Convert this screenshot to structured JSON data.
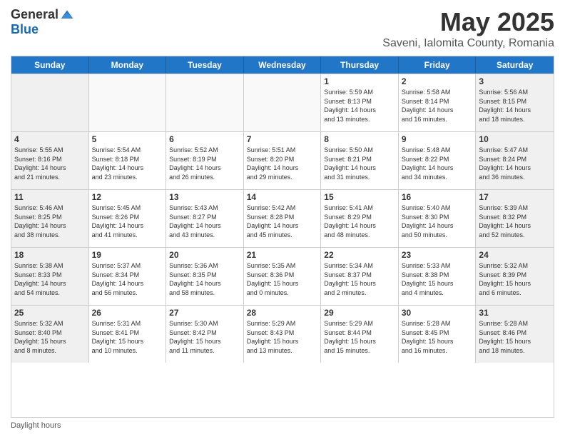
{
  "logo": {
    "general": "General",
    "blue": "Blue"
  },
  "title": "May 2025",
  "subtitle": "Saveni, Ialomita County, Romania",
  "days": [
    "Sunday",
    "Monday",
    "Tuesday",
    "Wednesday",
    "Thursday",
    "Friday",
    "Saturday"
  ],
  "rows": [
    [
      {
        "num": "",
        "info": ""
      },
      {
        "num": "",
        "info": ""
      },
      {
        "num": "",
        "info": ""
      },
      {
        "num": "",
        "info": ""
      },
      {
        "num": "1",
        "info": "Sunrise: 5:59 AM\nSunset: 8:13 PM\nDaylight: 14 hours\nand 13 minutes."
      },
      {
        "num": "2",
        "info": "Sunrise: 5:58 AM\nSunset: 8:14 PM\nDaylight: 14 hours\nand 16 minutes."
      },
      {
        "num": "3",
        "info": "Sunrise: 5:56 AM\nSunset: 8:15 PM\nDaylight: 14 hours\nand 18 minutes."
      }
    ],
    [
      {
        "num": "4",
        "info": "Sunrise: 5:55 AM\nSunset: 8:16 PM\nDaylight: 14 hours\nand 21 minutes."
      },
      {
        "num": "5",
        "info": "Sunrise: 5:54 AM\nSunset: 8:18 PM\nDaylight: 14 hours\nand 23 minutes."
      },
      {
        "num": "6",
        "info": "Sunrise: 5:52 AM\nSunset: 8:19 PM\nDaylight: 14 hours\nand 26 minutes."
      },
      {
        "num": "7",
        "info": "Sunrise: 5:51 AM\nSunset: 8:20 PM\nDaylight: 14 hours\nand 29 minutes."
      },
      {
        "num": "8",
        "info": "Sunrise: 5:50 AM\nSunset: 8:21 PM\nDaylight: 14 hours\nand 31 minutes."
      },
      {
        "num": "9",
        "info": "Sunrise: 5:48 AM\nSunset: 8:22 PM\nDaylight: 14 hours\nand 34 minutes."
      },
      {
        "num": "10",
        "info": "Sunrise: 5:47 AM\nSunset: 8:24 PM\nDaylight: 14 hours\nand 36 minutes."
      }
    ],
    [
      {
        "num": "11",
        "info": "Sunrise: 5:46 AM\nSunset: 8:25 PM\nDaylight: 14 hours\nand 38 minutes."
      },
      {
        "num": "12",
        "info": "Sunrise: 5:45 AM\nSunset: 8:26 PM\nDaylight: 14 hours\nand 41 minutes."
      },
      {
        "num": "13",
        "info": "Sunrise: 5:43 AM\nSunset: 8:27 PM\nDaylight: 14 hours\nand 43 minutes."
      },
      {
        "num": "14",
        "info": "Sunrise: 5:42 AM\nSunset: 8:28 PM\nDaylight: 14 hours\nand 45 minutes."
      },
      {
        "num": "15",
        "info": "Sunrise: 5:41 AM\nSunset: 8:29 PM\nDaylight: 14 hours\nand 48 minutes."
      },
      {
        "num": "16",
        "info": "Sunrise: 5:40 AM\nSunset: 8:30 PM\nDaylight: 14 hours\nand 50 minutes."
      },
      {
        "num": "17",
        "info": "Sunrise: 5:39 AM\nSunset: 8:32 PM\nDaylight: 14 hours\nand 52 minutes."
      }
    ],
    [
      {
        "num": "18",
        "info": "Sunrise: 5:38 AM\nSunset: 8:33 PM\nDaylight: 14 hours\nand 54 minutes."
      },
      {
        "num": "19",
        "info": "Sunrise: 5:37 AM\nSunset: 8:34 PM\nDaylight: 14 hours\nand 56 minutes."
      },
      {
        "num": "20",
        "info": "Sunrise: 5:36 AM\nSunset: 8:35 PM\nDaylight: 14 hours\nand 58 minutes."
      },
      {
        "num": "21",
        "info": "Sunrise: 5:35 AM\nSunset: 8:36 PM\nDaylight: 15 hours\nand 0 minutes."
      },
      {
        "num": "22",
        "info": "Sunrise: 5:34 AM\nSunset: 8:37 PM\nDaylight: 15 hours\nand 2 minutes."
      },
      {
        "num": "23",
        "info": "Sunrise: 5:33 AM\nSunset: 8:38 PM\nDaylight: 15 hours\nand 4 minutes."
      },
      {
        "num": "24",
        "info": "Sunrise: 5:32 AM\nSunset: 8:39 PM\nDaylight: 15 hours\nand 6 minutes."
      }
    ],
    [
      {
        "num": "25",
        "info": "Sunrise: 5:32 AM\nSunset: 8:40 PM\nDaylight: 15 hours\nand 8 minutes."
      },
      {
        "num": "26",
        "info": "Sunrise: 5:31 AM\nSunset: 8:41 PM\nDaylight: 15 hours\nand 10 minutes."
      },
      {
        "num": "27",
        "info": "Sunrise: 5:30 AM\nSunset: 8:42 PM\nDaylight: 15 hours\nand 11 minutes."
      },
      {
        "num": "28",
        "info": "Sunrise: 5:29 AM\nSunset: 8:43 PM\nDaylight: 15 hours\nand 13 minutes."
      },
      {
        "num": "29",
        "info": "Sunrise: 5:29 AM\nSunset: 8:44 PM\nDaylight: 15 hours\nand 15 minutes."
      },
      {
        "num": "30",
        "info": "Sunrise: 5:28 AM\nSunset: 8:45 PM\nDaylight: 15 hours\nand 16 minutes."
      },
      {
        "num": "31",
        "info": "Sunrise: 5:28 AM\nSunset: 8:46 PM\nDaylight: 15 hours\nand 18 minutes."
      }
    ]
  ],
  "footer": {
    "daylight_label": "Daylight hours"
  }
}
